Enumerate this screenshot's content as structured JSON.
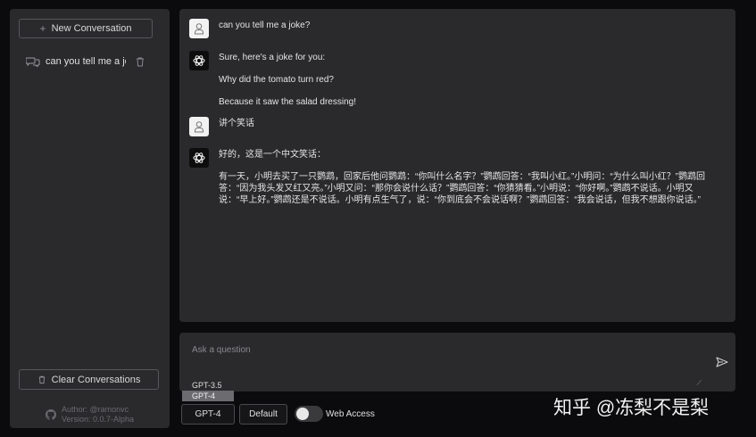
{
  "sidebar": {
    "new_conversation_label": "New Conversation",
    "conversations": [
      {
        "label": "can you tell me a jo"
      }
    ],
    "clear_label": "Clear Conversations",
    "author_line": "Author: @ramonvc",
    "version_line": "Version: 0.0.7-Alpha"
  },
  "messages": [
    {
      "role": "user",
      "lines": [
        "can you tell me a joke?"
      ]
    },
    {
      "role": "assistant",
      "lines": [
        "Sure, here's a joke for you:",
        "Why did the tomato turn red?",
        "Because it saw the salad dressing!"
      ]
    },
    {
      "role": "user",
      "lines": [
        "讲个笑话"
      ]
    },
    {
      "role": "assistant",
      "lines": [
        "好的，这是一个中文笑话：",
        "有一天，小明去买了一只鹦鹉，回家后他问鹦鹉：“你叫什么名字？”鹦鹉回答：“我叫小红。”小明问：“为什么叫小红？”鹦鹉回答：“因为我头发又红又亮。”小明又问：“那你会说什么话？”鹦鹉回答：“你猜猜看。”小明说：“你好啊。”鹦鹉不说话。小明又说：“早上好。”鹦鹉还是不说话。小明有点生气了，说：“你到底会不会说话啊？”鹦鹉回答：“我会说话，但我不想跟你说话。”"
      ]
    }
  ],
  "input": {
    "placeholder": "Ask a question"
  },
  "model_dropdown": {
    "options": [
      "GPT-3.5",
      "GPT-4"
    ],
    "selected": "GPT-4"
  },
  "controls": {
    "model_button_label": "GPT-4",
    "default_button_label": "Default",
    "web_access_label": "Web Access",
    "web_access_enabled": false
  },
  "watermark": "知乎 @冻梨不是梨"
}
